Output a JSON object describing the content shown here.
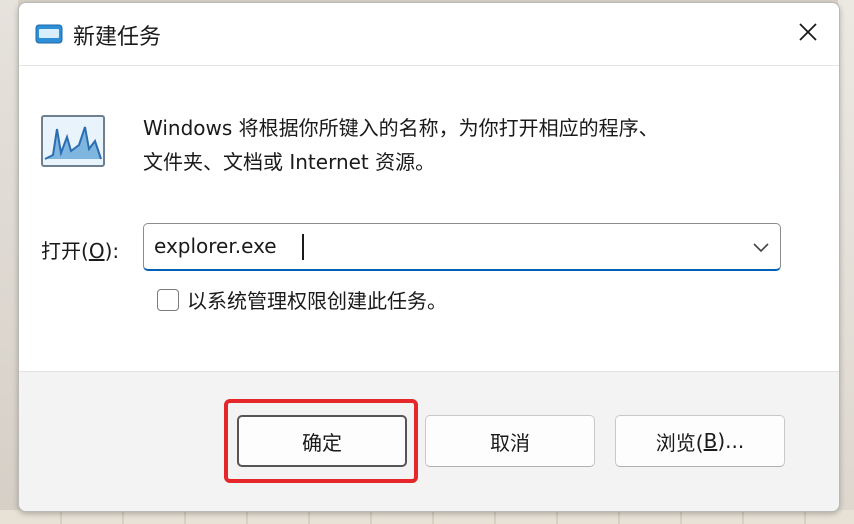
{
  "dialog": {
    "title": "新建任务",
    "description_line1": "Windows 将根据你所键入的名称，为你打开相应的程序、",
    "description_line2": "文件夹、文档或 Internet 资源。",
    "open_label_prefix": "打开(",
    "open_label_key": "O",
    "open_label_suffix": "):",
    "combo_value": "explorer.exe",
    "admin_checkbox_label": "以系统管理权限创建此任务。",
    "admin_checked": false,
    "ok_label": "确定",
    "cancel_label": "取消",
    "browse_label_prefix": "浏览(",
    "browse_label_key": "B",
    "browse_label_suffix": ")...",
    "highlight_color": "#e5262a",
    "accent_color": "#005fb8"
  },
  "icons": {
    "title": "run-dialog-icon",
    "app": "task-manager-graph-icon",
    "close": "close-icon",
    "dropdown": "chevron-down-icon"
  }
}
